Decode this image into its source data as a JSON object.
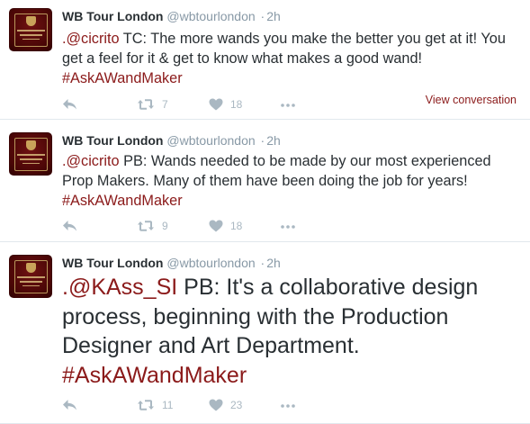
{
  "tweets": [
    {
      "name": "WB Tour London",
      "handle": "@wbtourlondon",
      "separator": "·",
      "time": "2h",
      "mention": ".@cicrito",
      "body": " TC: The more wands you make  the better you get at it! You get a feel for it & get to know what makes a good wand! ",
      "hashtag": "#AskAWandMaker",
      "view_conversation": "View conversation",
      "retweets": "7",
      "likes": "18"
    },
    {
      "name": "WB Tour London",
      "handle": "@wbtourlondon",
      "separator": "·",
      "time": "2h",
      "mention": ".@cicrito",
      "body": " PB: Wands needed to be made by our most experienced Prop Makers. Many of them have been doing the job for years! ",
      "hashtag": "#AskAWandMaker",
      "retweets": "9",
      "likes": "18"
    },
    {
      "name": "WB Tour London",
      "handle": "@wbtourlondon",
      "separator": "·",
      "time": "2h",
      "mention": ".@KAss_SI",
      "body": " PB: It's a collaborative design process, beginning with the Production Designer and Art Department. ",
      "hashtag": "#AskAWandMaker",
      "retweets": "11",
      "likes": "23"
    }
  ],
  "icons": {
    "avatar": "warner-bros-studio-tour-logo",
    "reply": "reply-icon",
    "retweet": "retweet-icon",
    "like": "heart-icon",
    "more": "more-dots-icon"
  },
  "colors": {
    "link": "#8b1a1a",
    "text": "#292f33",
    "muted": "#8899a6",
    "icon": "#aab8c2",
    "avatar_bg": "#4a0606"
  }
}
